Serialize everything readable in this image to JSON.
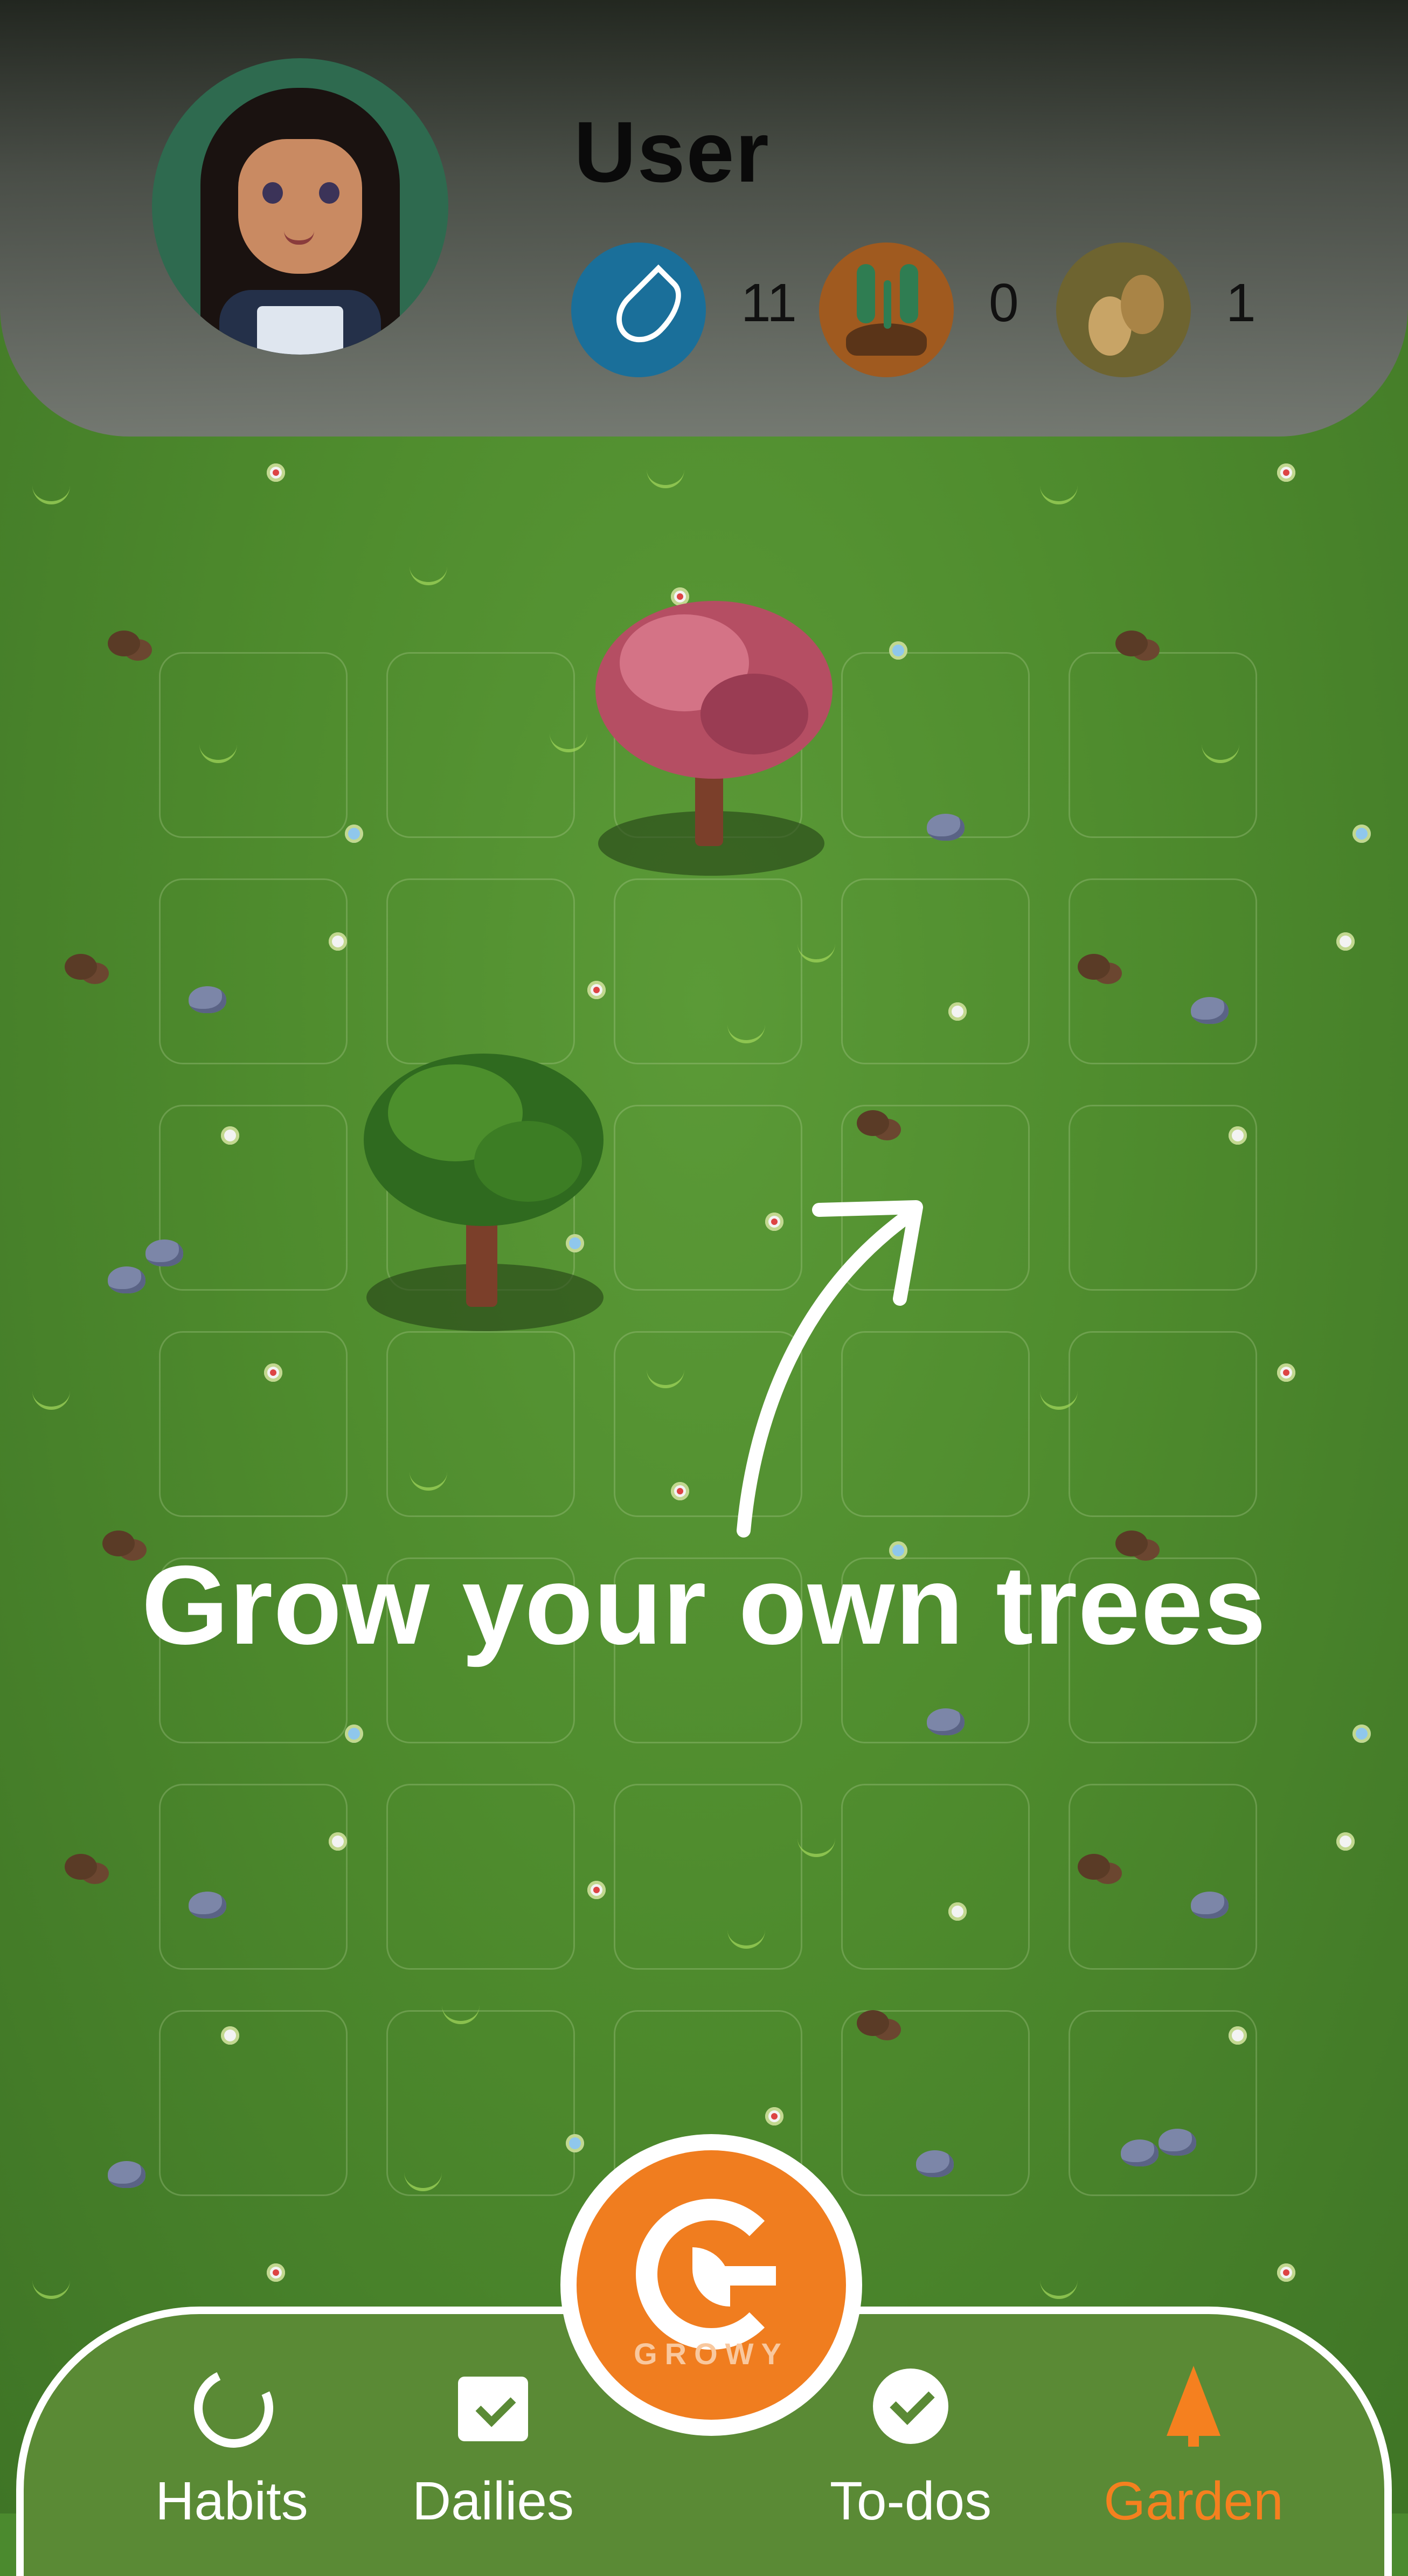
{
  "header": {
    "username": "User",
    "stats": [
      {
        "icon": "water-drop-icon",
        "value": "11"
      },
      {
        "icon": "seedling-soil-icon",
        "value": "0"
      },
      {
        "icon": "seeds-icon",
        "value": "1"
      }
    ]
  },
  "headline": "Grow your own trees",
  "fab": {
    "brand": "GROWY"
  },
  "nav": {
    "items": [
      {
        "label": "Habits",
        "icon": "habits-ring-icon"
      },
      {
        "label": "Dailies",
        "icon": "calendar-check-icon"
      },
      {
        "label": "To-dos",
        "icon": "check-circle-icon"
      },
      {
        "label": "Garden",
        "icon": "tree-icon"
      }
    ],
    "active": "Garden"
  },
  "colors": {
    "accent": "#f07d1f",
    "grass": "#4e8b2d",
    "nav_bg": "#5a8a35"
  }
}
